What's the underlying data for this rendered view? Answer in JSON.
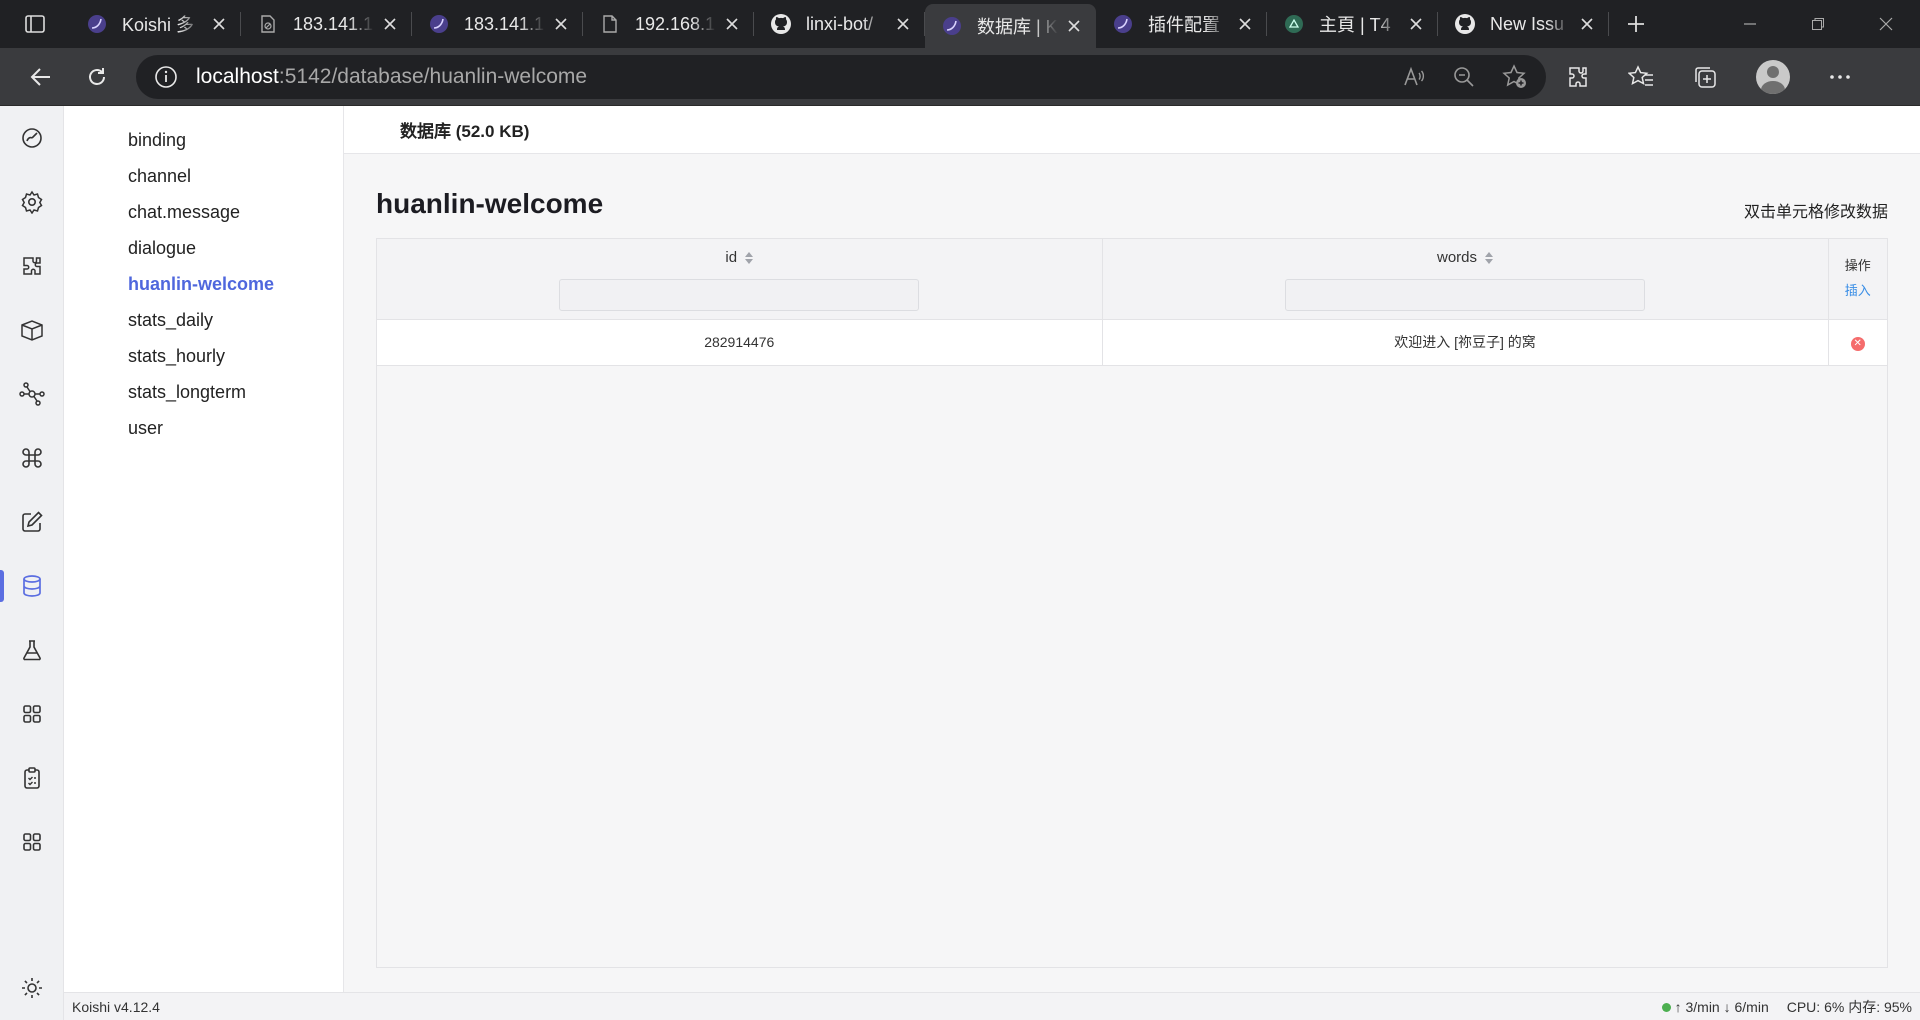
{
  "browser": {
    "tabs": [
      {
        "title": "Koishi 多",
        "icon": "koishi-icon",
        "active": false
      },
      {
        "title": "183.141.1",
        "icon": "blocked-page-icon",
        "active": false
      },
      {
        "title": "183.141.1",
        "icon": "koishi-icon",
        "active": false
      },
      {
        "title": "192.168.1",
        "icon": "document-icon",
        "active": false
      },
      {
        "title": "linxi-bot/",
        "icon": "github-icon",
        "active": false
      },
      {
        "title": "数据库 | K",
        "icon": "koishi-icon",
        "active": true
      },
      {
        "title": "插件配置",
        "icon": "koishi-icon",
        "active": false
      },
      {
        "title": "主頁 | T4",
        "icon": "t4-icon",
        "active": false
      },
      {
        "title": "New Issu",
        "icon": "github-icon",
        "active": false
      }
    ],
    "url_host": "localhost",
    "url_rest": ":5142/database/huanlin-welcome"
  },
  "sidebar": {
    "tables": [
      {
        "label": "binding"
      },
      {
        "label": "channel"
      },
      {
        "label": "chat.message"
      },
      {
        "label": "dialogue"
      },
      {
        "label": "huanlin-welcome",
        "active": true
      },
      {
        "label": "stats_daily"
      },
      {
        "label": "stats_hourly"
      },
      {
        "label": "stats_longterm"
      },
      {
        "label": "user"
      }
    ]
  },
  "activity_bar": [
    "dashboard-icon",
    "settings-icon",
    "plugin-icon",
    "market-icon",
    "dependency-icon",
    "command-icon",
    "edit-icon",
    "database-icon",
    "sandbox-icon",
    "apps-icon",
    "logs-icon",
    "apps-icon-2",
    "theme-icon"
  ],
  "main": {
    "header": "数据库 (52.0 KB)",
    "title": "huanlin-welcome",
    "hint": "双击单元格修改数据",
    "columns": [
      "id",
      "words"
    ],
    "op_header": "操作",
    "op_insert": "插入",
    "rows": [
      {
        "id": "282914476",
        "words": "欢迎进入 [祢豆子] 的窝"
      }
    ]
  },
  "status": {
    "version": "Koishi v4.12.4",
    "rate": "↑ 3/min ↓ 6/min",
    "system": "CPU: 6% 内存: 95%"
  }
}
